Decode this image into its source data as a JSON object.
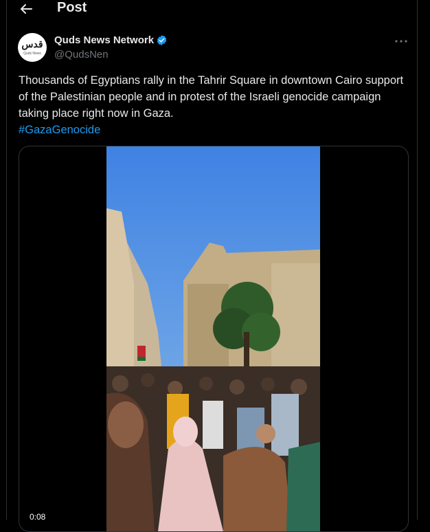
{
  "header": {
    "title": "Post",
    "back_icon": "arrow-left-icon"
  },
  "author": {
    "display_name": "Quds News Network",
    "handle": "@QudsNen",
    "verified": true,
    "avatar_logo_text": "قدس",
    "avatar_logo_subtext": "Quds News"
  },
  "post": {
    "text": "Thousands of Egyptians rally in the Tahrir Square in downtown Cairo support of the Palestinian people and in protest of the Israeli genocide campaign taking place right now in Gaza.",
    "hashtag": "#GazaGenocide"
  },
  "media": {
    "type": "video",
    "timestamp": "0:08"
  },
  "colors": {
    "accent": "#1d9bf0",
    "text": "#e7e9ea",
    "muted": "#71767b",
    "border": "#2f3336",
    "background": "#000000"
  }
}
